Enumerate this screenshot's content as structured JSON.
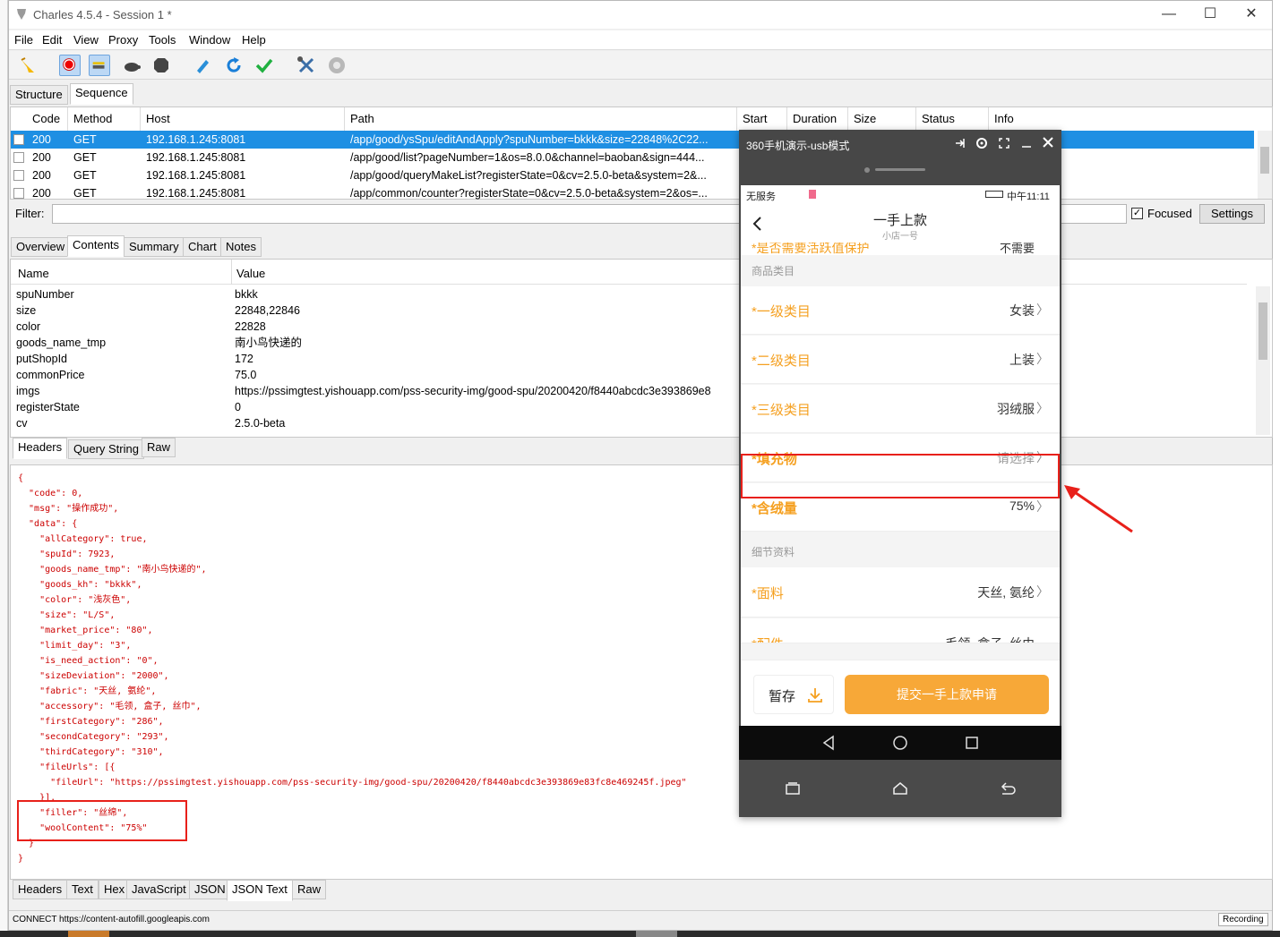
{
  "window": {
    "title": "Charles 4.5.4 - Session 1 *",
    "controls": {
      "minimize": "—",
      "maximize": "☐",
      "close": "✕"
    }
  },
  "menu": [
    "File",
    "Edit",
    "View",
    "Proxy",
    "Tools",
    "Window",
    "Help"
  ],
  "toolbar": [
    "broom-icon",
    "record-icon",
    "throttle-icon",
    "turtle-icon",
    "stop-icon",
    "pen-icon",
    "refresh-icon",
    "check-icon",
    "tools-icon",
    "gear-icon"
  ],
  "view_tabs": {
    "structure": "Structure",
    "sequence": "Sequence"
  },
  "seq_table": {
    "headers": {
      "code": "Code",
      "method": "Method",
      "host": "Host",
      "path": "Path",
      "start": "Start",
      "duration": "Duration",
      "size": "Size",
      "status": "Status",
      "info": "Info"
    },
    "rows": [
      {
        "code": "200",
        "method": "GET",
        "host": "192.168.1.245:8081",
        "path": "/app/good/ysSpu/editAndApply?spuNumber=bkkk&size=22848%2C22..."
      },
      {
        "code": "200",
        "method": "GET",
        "host": "192.168.1.245:8081",
        "path": "/app/good/list?pageNumber=1&os=8.0.0&channel=baoban&sign=444..."
      },
      {
        "code": "200",
        "method": "GET",
        "host": "192.168.1.245:8081",
        "path": "/app/good/queryMakeList?registerState=0&cv=2.5.0-beta&system=2&..."
      },
      {
        "code": "200",
        "method": "GET",
        "host": "192.168.1.245:8081",
        "path": "/app/common/counter?registerState=0&cv=2.5.0-beta&system=2&os=..."
      }
    ]
  },
  "filter": {
    "label": "Filter:",
    "focused": "Focused",
    "settings": "Settings"
  },
  "detail_tabs": [
    "Overview",
    "Contents",
    "Summary",
    "Chart",
    "Notes"
  ],
  "params": {
    "headers": {
      "name": "Name",
      "value": "Value"
    },
    "rows": [
      {
        "name": "spuNumber",
        "value": "bkkk"
      },
      {
        "name": "size",
        "value": "22848,22846"
      },
      {
        "name": "color",
        "value": "22828"
      },
      {
        "name": "goods_name_tmp",
        "value": "南小鸟快递的"
      },
      {
        "name": "putShopId",
        "value": "172"
      },
      {
        "name": "commonPrice",
        "value": "75.0"
      },
      {
        "name": "imgs",
        "value": "https://pssimgtest.yishouapp.com/pss-security-img/good-spu/20200420/f8440abcdc3e393869e8"
      },
      {
        "name": "registerState",
        "value": "0"
      },
      {
        "name": "cv",
        "value": "2.5.0-beta"
      }
    ]
  },
  "request_tabs": [
    "Headers",
    "Query String",
    "Raw"
  ],
  "json_lines": [
    "{",
    "  \"code\": 0,",
    "  \"msg\": \"操作成功\",",
    "  \"data\": {",
    "    \"allCategory\": true,",
    "    \"spuId\": 7923,",
    "    \"goods_name_tmp\": \"南小鸟快递的\",",
    "    \"goods_kh\": \"bkkk\",",
    "    \"color\": \"浅灰色\",",
    "    \"size\": \"L/S\",",
    "    \"market_price\": \"80\",",
    "    \"limit_day\": \"3\",",
    "    \"is_need_action\": \"0\",",
    "    \"sizeDeviation\": \"2000\",",
    "    \"fabric\": \"天丝, 氨纶\",",
    "    \"accessory\": \"毛领, 盒子, 丝巾\",",
    "    \"firstCategory\": \"286\",",
    "    \"secondCategory\": \"293\",",
    "    \"thirdCategory\": \"310\",",
    "    \"fileUrls\": [{",
    "      \"fileUrl\": \"https://pssimgtest.yishouapp.com/pss-security-img/good-spu/20200420/f8440abcdc3e393869e83fc8e469245f.jpeg\"",
    "    }],",
    "    \"filler\": \"丝绵\",",
    "    \"woolContent\": \"75%\"",
    "  }",
    "}"
  ],
  "response_tabs": [
    "Headers",
    "Text",
    "Hex",
    "JavaScript",
    "JSON",
    "JSON Text",
    "Raw"
  ],
  "status": {
    "left": "CONNECT https://content-autofill.googleapis.com",
    "right": "Recording"
  },
  "phone": {
    "title": "360手机演示-usb模式",
    "statusbar_left": "无服务",
    "statusbar_right": "中午11:11",
    "page_title": "一手上款",
    "page_subtitle": "小店一号",
    "partial_row": {
      "label": "*是否需要活跃值保护",
      "value": "不需要"
    },
    "section1": "商品类目",
    "rows1": [
      {
        "label": "*一级类目",
        "value": "女装"
      },
      {
        "label": "*二级类目",
        "value": "上装"
      },
      {
        "label": "*三级类目",
        "value": "羽绒服"
      },
      {
        "label": "*填充物",
        "value": "请选择"
      },
      {
        "label": "*含绒量",
        "value": "75%"
      }
    ],
    "section2": "细节资料",
    "rows2": [
      {
        "label": "*面料",
        "value": "天丝, 氨纶"
      },
      {
        "label": "*配件",
        "value": "毛领, 盒子, 丝巾"
      }
    ],
    "save_button": "暂存",
    "submit_button": "提交一手上款申请"
  }
}
